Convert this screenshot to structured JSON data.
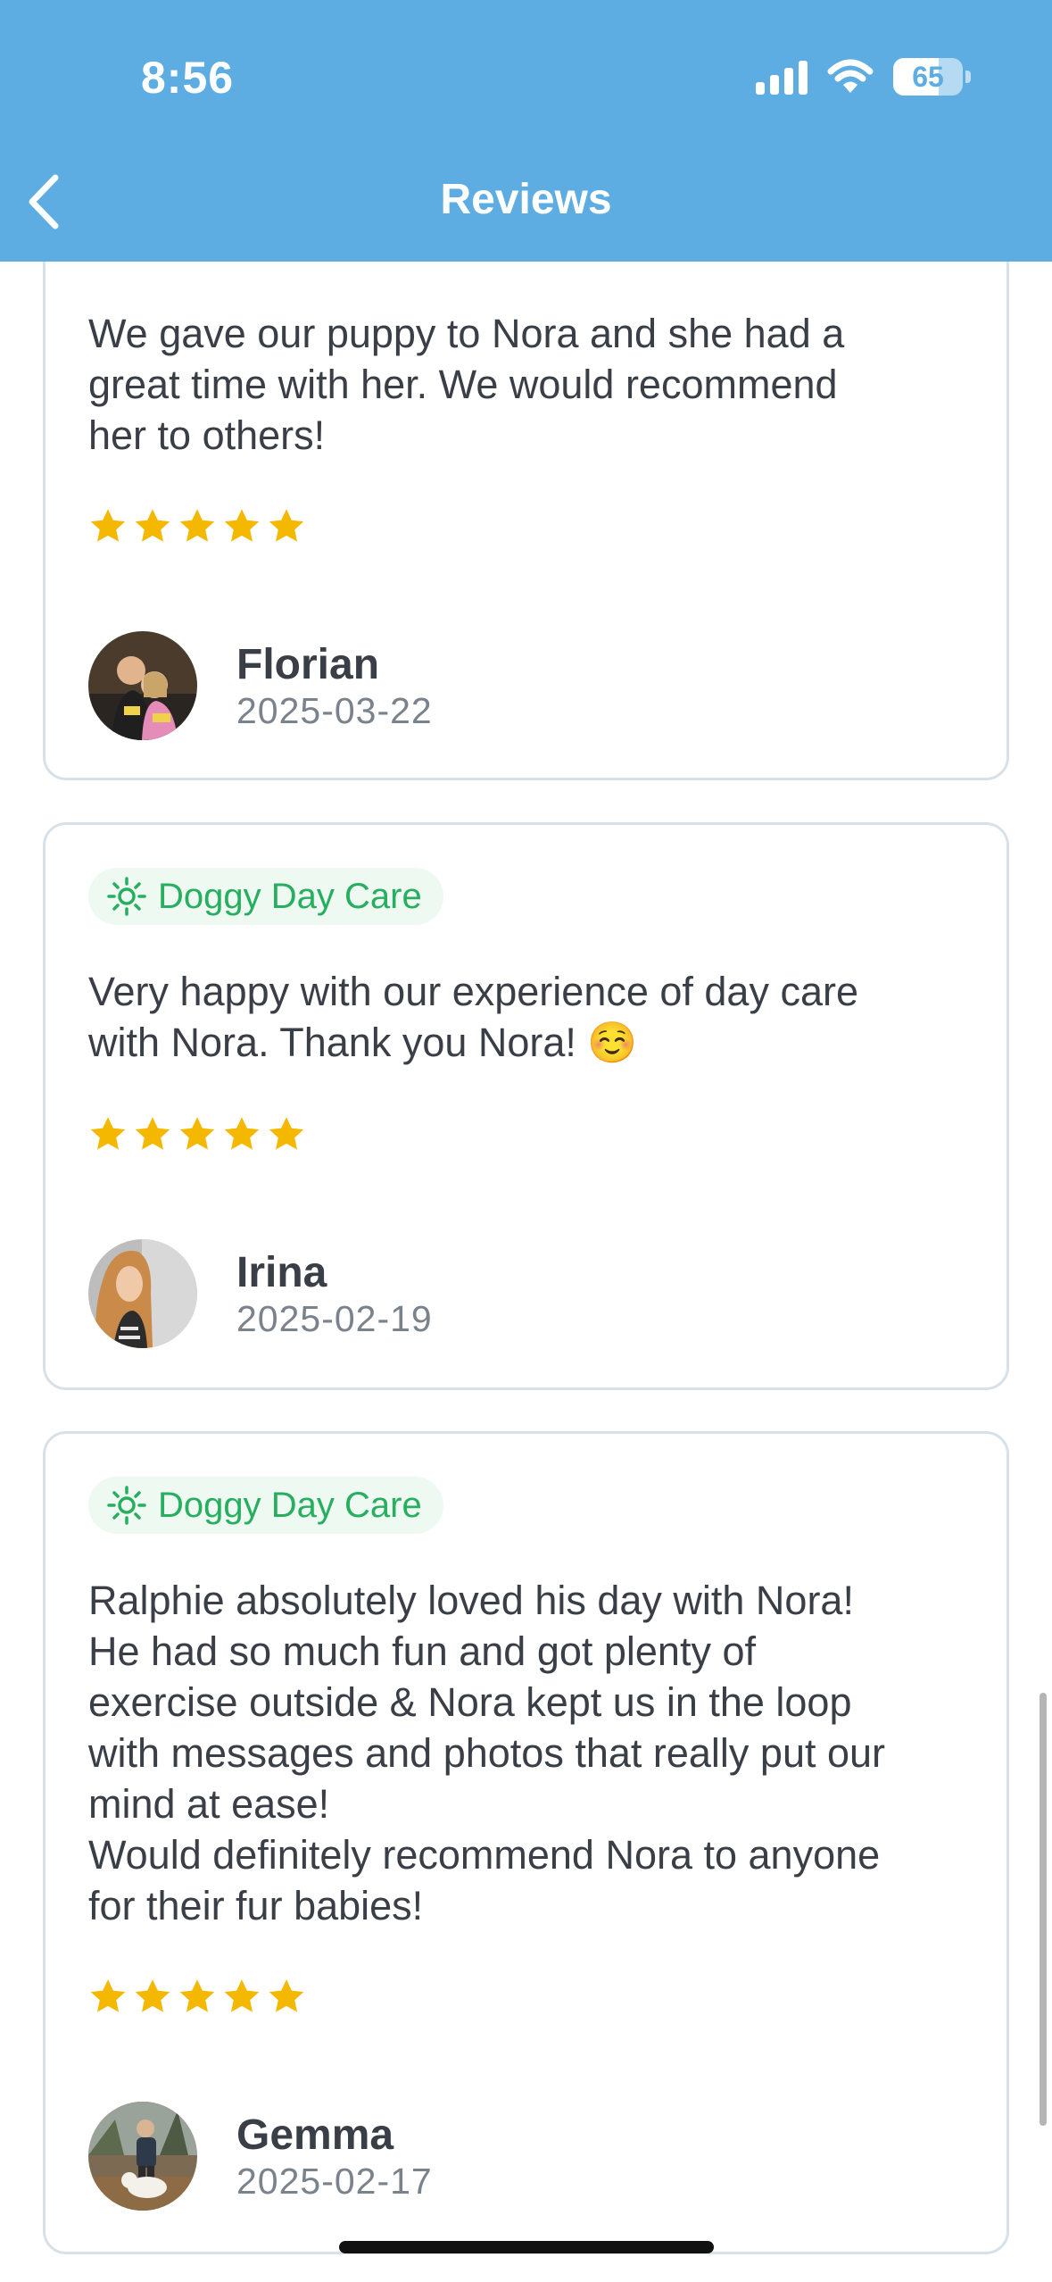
{
  "status_bar": {
    "time": "8:56",
    "battery_level": "65",
    "battery_fraction": 0.65
  },
  "header": {
    "title": "Reviews",
    "back_icon": "chevron-left-icon",
    "background_color": "#5dade2"
  },
  "colors": {
    "star": "#f5b800",
    "badge_text": "#27ae60",
    "badge_bg": "#edf9f1",
    "card_border": "#d8e1e8"
  },
  "reviews": [
    {
      "service": "",
      "text": "We gave our puppy to Nora and she had a\ngreat time with her. We would recommend\nher to others!",
      "rating": 5,
      "reviewer": "Florian",
      "date": "2025-03-22"
    },
    {
      "service": "Doggy Day Care",
      "service_icon": "sun-icon",
      "text": "Very happy with our experience of day care\nwith Nora. Thank you Nora! ☺️",
      "rating": 5,
      "reviewer": "Irina",
      "date": "2025-02-19"
    },
    {
      "service": "Doggy Day Care",
      "service_icon": "sun-icon",
      "text": "Ralphie absolutely loved his day with Nora!\nHe had so much fun and got plenty of\nexercise outside & Nora kept us in the loop\nwith messages and photos that really put our\nmind at ease!\nWould definitely recommend Nora to anyone\nfor their fur babies!",
      "rating": 5,
      "reviewer": "Gemma",
      "date": "2025-02-17"
    }
  ]
}
